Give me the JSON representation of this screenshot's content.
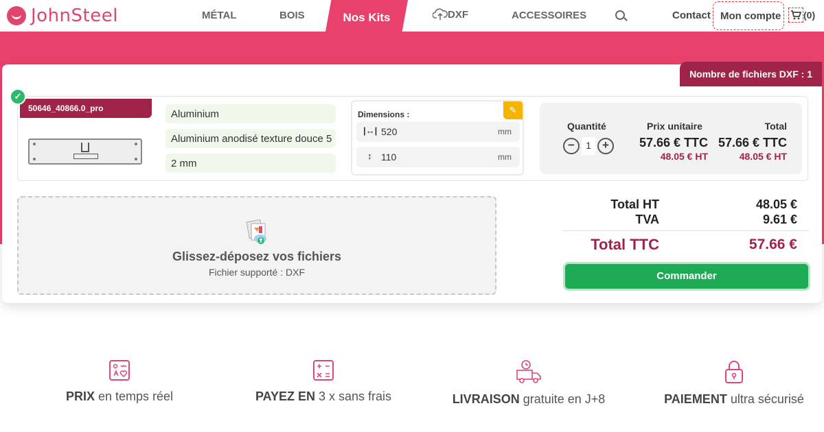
{
  "brand": {
    "name": "JohnSteel",
    "accent": "#e8426c",
    "dark_accent": "#a0234a"
  },
  "nav": {
    "items": [
      "MÉTAL",
      "BOIS"
    ],
    "active": "Nos Kits",
    "dxf": "DXF",
    "accessories": "ACCESSOIRES",
    "contact": "Contact",
    "account": "Mon compte",
    "cart": "(0)"
  },
  "dxf_count": "Nombre de fichiers DXF : 1",
  "file": {
    "name": "50646_40866.0_pro",
    "material": "Aluminium",
    "finish": "Aluminium anodisé texture douce 5",
    "thickness": "2 mm",
    "dimensions": {
      "title": "Dimensions :",
      "width": "520",
      "height": "110",
      "unit": "mm"
    }
  },
  "pricing": {
    "qty_label": "Quantité",
    "qty": "1",
    "unit_label": "Prix unitaire",
    "total_label": "Total",
    "unit_ttc": "57.66 € TTC",
    "unit_ht": "48.05 € HT",
    "total_ttc": "57.66 € TTC",
    "total_ht": "48.05 € HT"
  },
  "dropzone": {
    "title": "Glissez-déposez vos fichiers",
    "subtitle": "Fichier supporté : DXF"
  },
  "totals": {
    "ht_label": "Total HT",
    "ht": "48.05 €",
    "tva_label": "TVA",
    "tva": "9.61 €",
    "ttc_label": "Total TTC",
    "ttc": "57.66 €"
  },
  "order_button": "Commander",
  "features": [
    {
      "bold": "PRIX",
      "rest": " en temps réel"
    },
    {
      "bold": "PAYEZ EN",
      "rest": " 3 x sans frais"
    },
    {
      "bold": "LIVRAISON",
      "rest": " gratuite en J+8"
    },
    {
      "bold": "PAIEMENT",
      "rest": " ultra sécurisé"
    }
  ]
}
